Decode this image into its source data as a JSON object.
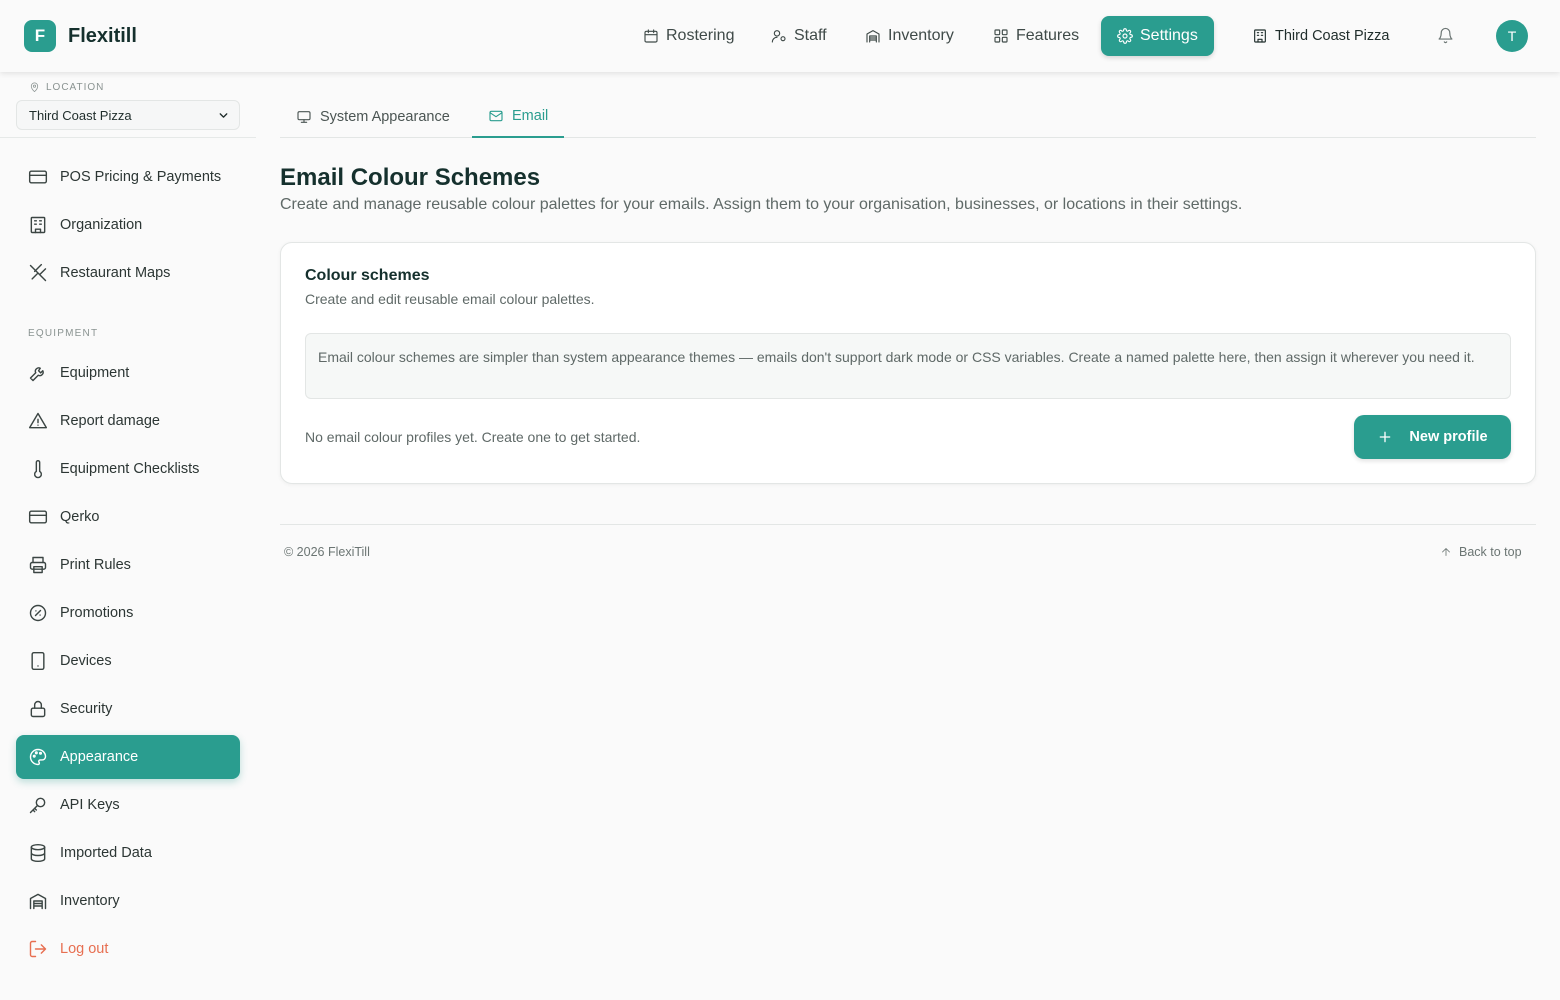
{
  "brand": {
    "logo_letter": "F",
    "name": "Flexitill"
  },
  "topnav": {
    "items": [
      {
        "label": "Rostering",
        "icon": "calendar-icon"
      },
      {
        "label": "Staff",
        "icon": "user-settings-icon"
      },
      {
        "label": "Inventory",
        "icon": "warehouse-icon"
      },
      {
        "label": "Features",
        "icon": "grid-icon"
      },
      {
        "label": "Settings",
        "icon": "gear-icon",
        "active": true
      }
    ],
    "location": "Third Coast Pizza",
    "avatar_letter": "T"
  },
  "sidebar": {
    "location_label": "LOCATION",
    "location_value": "Third Coast Pizza",
    "items": [
      {
        "label": "POS Pricing & Payments",
        "icon": "credit-card-icon"
      },
      {
        "label": "Organization",
        "icon": "building-icon"
      },
      {
        "label": "Restaurant Maps",
        "icon": "utensils-crossed-icon"
      }
    ],
    "equipment_section": "EQUIPMENT",
    "equipment_items": [
      {
        "label": "Equipment",
        "icon": "wrench-icon"
      },
      {
        "label": "Report damage",
        "icon": "warning-icon"
      },
      {
        "label": "Equipment Checklists",
        "icon": "thermometer-icon"
      },
      {
        "label": "Qerko",
        "icon": "credit-card-icon"
      },
      {
        "label": "Print Rules",
        "icon": "printer-icon"
      },
      {
        "label": "Promotions",
        "icon": "badge-percent-icon"
      },
      {
        "label": "Devices",
        "icon": "tablet-icon"
      },
      {
        "label": "Security",
        "icon": "lock-icon"
      },
      {
        "label": "Appearance",
        "icon": "palette-icon",
        "active": true
      },
      {
        "label": "API Keys",
        "icon": "key-icon"
      },
      {
        "label": "Imported Data",
        "icon": "database-icon"
      },
      {
        "label": "Inventory",
        "icon": "warehouse-icon"
      }
    ],
    "logout_label": "Log out"
  },
  "tabs": [
    {
      "label": "System Appearance",
      "icon": "monitor-icon"
    },
    {
      "label": "Email",
      "icon": "mail-icon",
      "active": true
    }
  ],
  "page": {
    "title": "Email Colour Schemes",
    "subtitle": "Create and manage reusable colour palettes for your emails. Assign them to your organisation, businesses, or locations in their settings."
  },
  "card": {
    "title": "Colour schemes",
    "subtitle": "Create and edit reusable email colour palettes.",
    "info": "Email colour schemes are simpler than system appearance themes — emails don't support dark mode or CSS variables. Create a named palette here, then assign it wherever you need it.",
    "empty_text": "No email colour profiles yet. Create one to get started.",
    "new_button": "New profile"
  },
  "footer": {
    "copyright": "© 2026 FlexiTill",
    "back_to_top": "Back to top"
  },
  "colors": {
    "accent": "#2a9d8f",
    "danger": "#e76f51"
  }
}
